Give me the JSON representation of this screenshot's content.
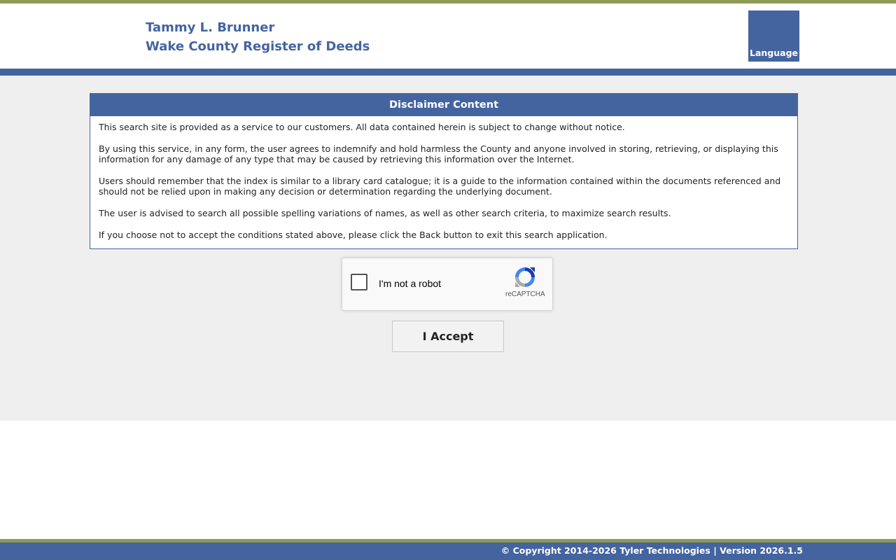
{
  "header": {
    "title_line1": "Tammy L. Brunner",
    "title_line2": "Wake County Register of Deeds",
    "language_button": "Language"
  },
  "disclaimer": {
    "heading": "Disclaimer Content",
    "paragraphs": [
      "This search site is provided as a service to our customers. All data contained herein is subject to change without notice.",
      "By using this service, in any form, the user agrees to indemnify and hold harmless the County and anyone involved in storing, retrieving, or displaying this information for any damage of any type that may be caused by retrieving this information over the Internet.",
      "Users should remember that the index is similar to a library card catalogue; it is a guide to the information contained within the documents referenced and should not be relied upon in making any decision or determination regarding the underlying document.",
      "The user is advised to search all possible spelling variations of names, as well as other search criteria, to maximize search results.",
      "If you choose not to accept the conditions stated above, please click the Back button to exit this search application."
    ]
  },
  "recaptcha": {
    "label": "I'm not a robot",
    "brand": "reCAPTCHA",
    "checked": false,
    "icon": "recaptcha-logo-icon"
  },
  "accept_button": "I Accept",
  "footer": {
    "text": "© Copyright 2014-2026 Tyler Technologies | Version 2026.1.5"
  },
  "colors": {
    "brand_blue": "#4464a0",
    "accent_olive": "#8f9a55",
    "content_bg": "#efefef"
  }
}
